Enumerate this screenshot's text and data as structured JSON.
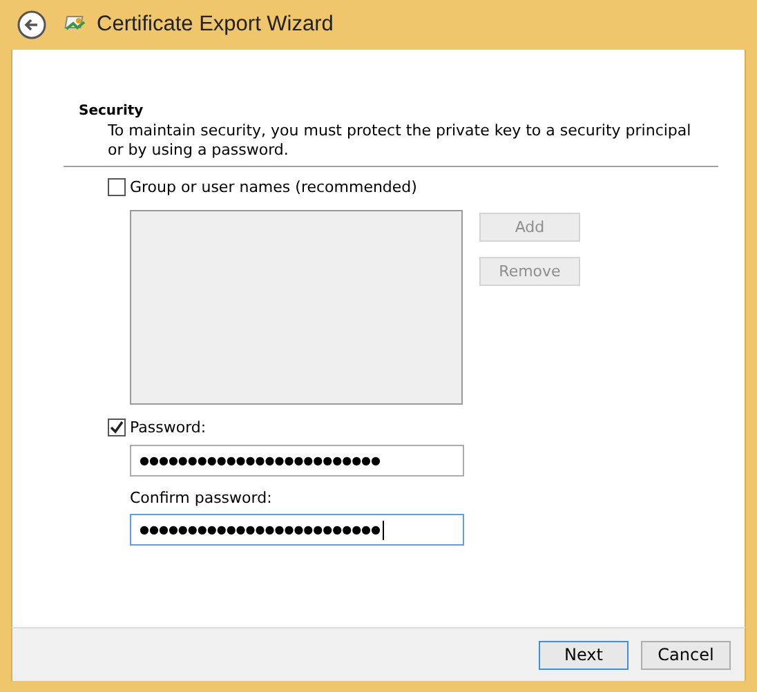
{
  "window": {
    "title": "Certificate Export Wizard"
  },
  "section": {
    "heading": "Security",
    "description": "To maintain security, you must protect the private key to a security principal or by using a password."
  },
  "group_option": {
    "label": "Group or user names (recommended)",
    "checked": false
  },
  "side_buttons": [
    {
      "label": "Add",
      "disabled": true
    },
    {
      "label": "Remove",
      "disabled": true
    }
  ],
  "password_option": {
    "label": "Password:",
    "checked": true
  },
  "password_field": {
    "value": "●●●●●●●●●●●●●●●●●●●●●●●●●",
    "focused": false
  },
  "confirm_label": "Confirm password:",
  "confirm_field": {
    "value": "●●●●●●●●●●●●●●●●●●●●●●●●●",
    "focused": true
  },
  "footer_buttons": [
    {
      "label": "Next",
      "default": true
    },
    {
      "label": "Cancel",
      "default": false
    }
  ]
}
